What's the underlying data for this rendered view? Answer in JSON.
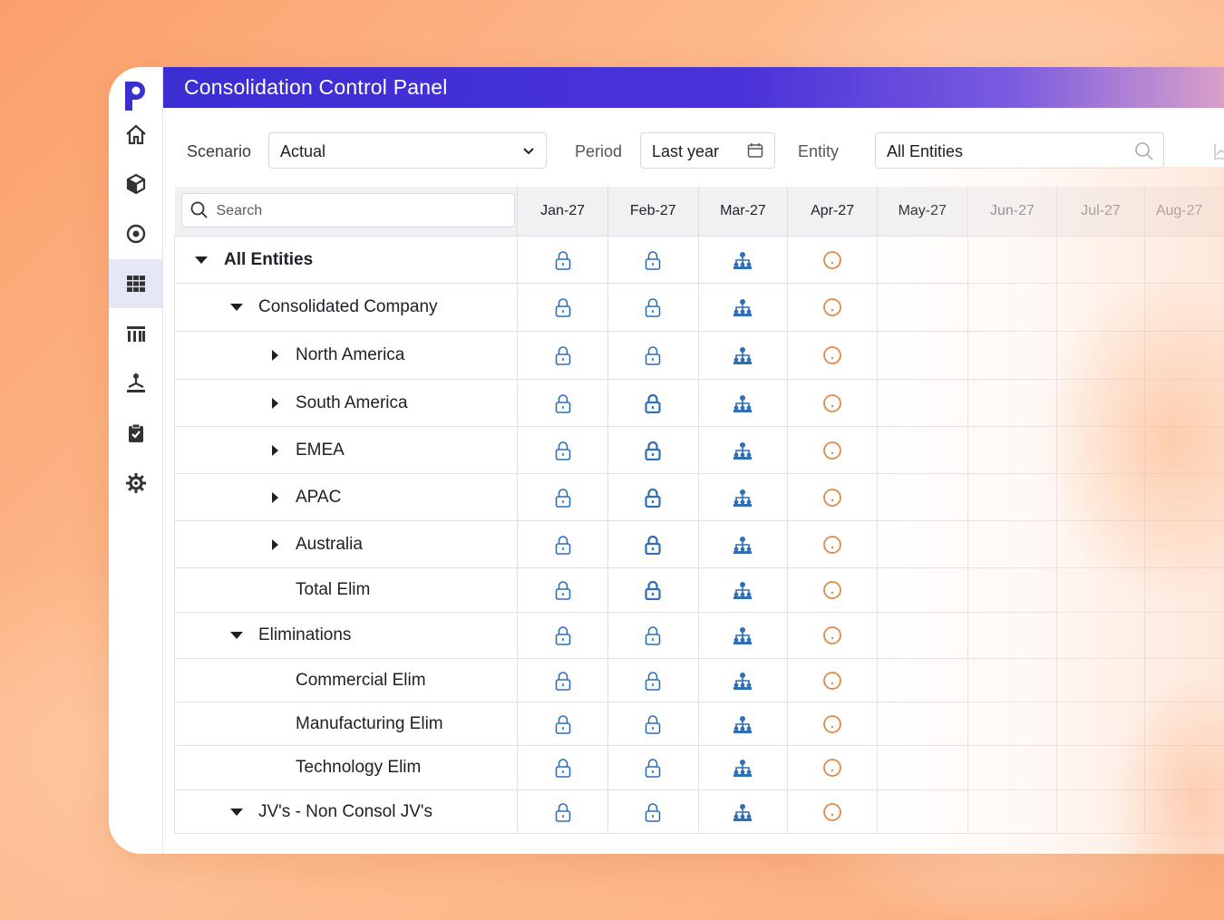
{
  "app": {
    "title": "Consolidation Control Panel",
    "accent": "#3b2ed2",
    "brand_logo": "P"
  },
  "sidebar": {
    "items": [
      {
        "icon": "home-icon"
      },
      {
        "icon": "cube-icon"
      },
      {
        "icon": "target-icon"
      },
      {
        "icon": "grid-icon",
        "active": true
      },
      {
        "icon": "building-icon"
      },
      {
        "icon": "hierarchy-icon"
      },
      {
        "icon": "clipboard-check-icon"
      },
      {
        "icon": "gear-icon"
      }
    ]
  },
  "filters": {
    "scenario_label": "Scenario",
    "scenario_value": "Actual",
    "period_label": "Period",
    "period_value": "Last year",
    "entity_label": "Entity",
    "entity_value": "All Entities"
  },
  "grid": {
    "search_placeholder": "Search",
    "months": [
      "Jan-27",
      "Feb-27",
      "Mar-27",
      "Apr-27",
      "May-27",
      "Jun-27",
      "Jul-27",
      "Aug-27"
    ],
    "status_colors": {
      "lock": "#2f6fb5",
      "hierarchy": "#2f6fb5",
      "pending": "#e08a4a"
    },
    "rows": [
      {
        "name": "All Entities",
        "level": 0,
        "toggle": "expanded",
        "bold": true
      },
      {
        "name": "Consolidated Company",
        "level": 1,
        "toggle": "expanded"
      },
      {
        "name": "North America",
        "level": 2,
        "toggle": "collapsed"
      },
      {
        "name": "South America",
        "level": 2,
        "toggle": "collapsed"
      },
      {
        "name": "EMEA",
        "level": 2,
        "toggle": "collapsed"
      },
      {
        "name": "APAC",
        "level": 2,
        "toggle": "collapsed"
      },
      {
        "name": "Australia",
        "level": 2,
        "toggle": "collapsed"
      },
      {
        "name": "Total Elim",
        "level": 2,
        "toggle": "none"
      },
      {
        "name": "Eliminations",
        "level": 1,
        "toggle": "expanded"
      },
      {
        "name": "Commercial Elim",
        "level": 2,
        "toggle": "none"
      },
      {
        "name": "Manufacturing Elim",
        "level": 2,
        "toggle": "none"
      },
      {
        "name": "Technology Elim",
        "level": 2,
        "toggle": "none"
      },
      {
        "name": "JV's - Non Consol JV's",
        "level": 1,
        "toggle": "expanded"
      }
    ],
    "row_status": [
      "lock",
      "lock",
      "hierarchy",
      "pending"
    ]
  }
}
